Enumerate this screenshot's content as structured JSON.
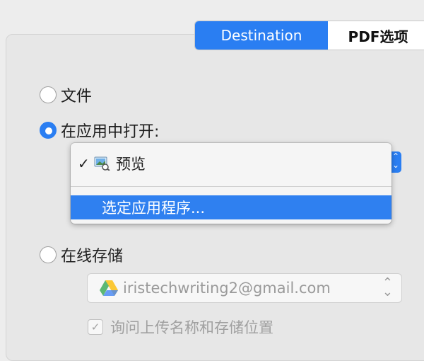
{
  "tabs": {
    "destination": "Destination",
    "pdf_options": "PDF选项"
  },
  "options": {
    "file": "文件",
    "open_in_app": "在应用中打开:",
    "online_storage": "在线存储"
  },
  "app_menu": {
    "selected_item": "预览",
    "choose_app": "选定应用程序..."
  },
  "storage": {
    "account": "iristechwriting2@gmail.com",
    "ask_location": "询问上传名称和存储位置"
  },
  "colors": {
    "accent": "#2a7ef2"
  },
  "icons": {
    "check": "checkmark-icon",
    "preview": "preview-app-icon",
    "drive": "google-drive-icon"
  }
}
